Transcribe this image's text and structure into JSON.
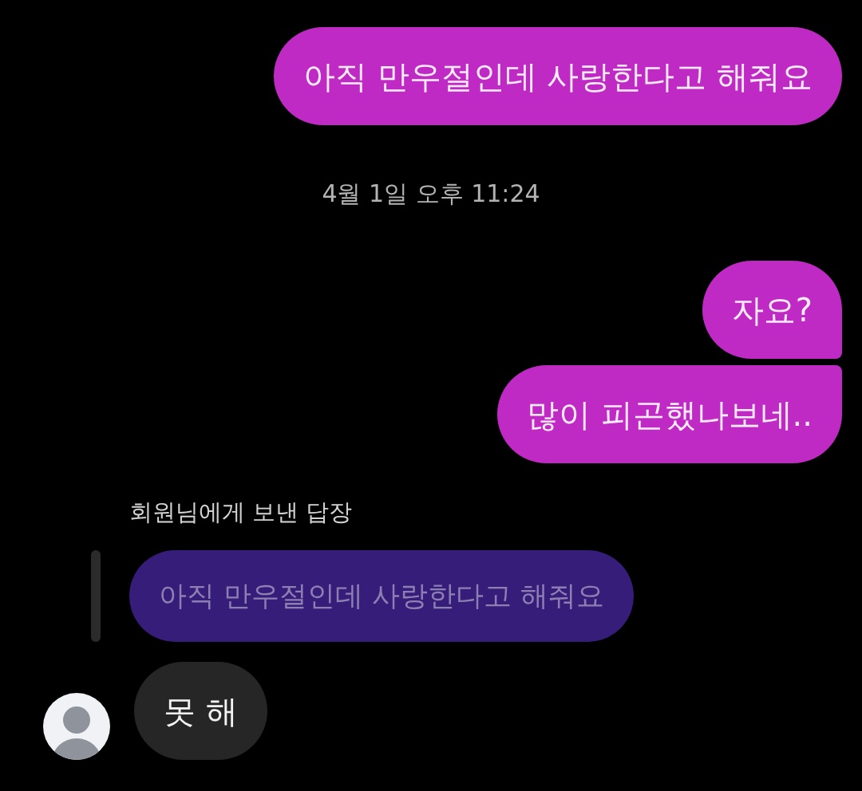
{
  "messages": [
    {
      "kind": "outgoing",
      "text": "아직 만우절인데 사랑한다고 해줘요"
    },
    {
      "kind": "timestamp",
      "text": "4월 1일 오후 11:24"
    },
    {
      "kind": "outgoing",
      "text": "자요?"
    },
    {
      "kind": "outgoing",
      "text": "많이 피곤했나보네.."
    },
    {
      "kind": "incoming",
      "reply_to": {
        "label": "회원님에게 보낸 답장",
        "text": "아직 만우절인데 사랑한다고 해줘요"
      },
      "text": "못 해"
    }
  ]
}
